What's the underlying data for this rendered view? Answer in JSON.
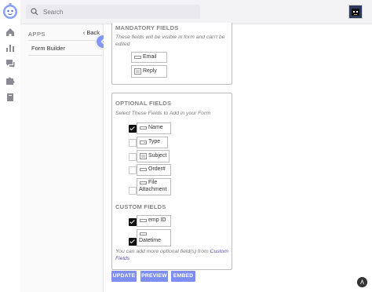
{
  "search": {
    "placeholder": "Search"
  },
  "apps": {
    "header": "APPS",
    "back_label": "Back",
    "items": [
      {
        "label": "Form Builder"
      }
    ]
  },
  "mandatory": {
    "title": "MANDATORY FIELDS",
    "description": "These fields will be visible in form and can't be edited",
    "fields": [
      {
        "label": "Email"
      },
      {
        "label": "Reply"
      }
    ]
  },
  "optional": {
    "title": "OPTIONAL FIELDS",
    "description": "Select These Fields to Add in your Form",
    "fields": [
      {
        "label": "Name",
        "checked": true
      },
      {
        "label": "Type",
        "checked": false
      },
      {
        "label": "Subject",
        "checked": false
      },
      {
        "label": "Order#",
        "checked": false
      },
      {
        "label": "File",
        "label2": "Attachment",
        "checked": false
      }
    ]
  },
  "custom": {
    "title": "CUSTOM FIELDS",
    "fields": [
      {
        "label": "emp ID",
        "checked": true
      },
      {
        "label": "Datetime",
        "checked": true
      }
    ],
    "note_prefix": "You can add more optional field(s) from",
    "note_link": "Custom",
    "note_link2": "Fields"
  },
  "buttons": {
    "update": "UPDATE",
    "preview": "PREVIEW",
    "embed": "EMBED"
  },
  "colors": {
    "accent": "#7f8ff0",
    "link": "#5a4fb8"
  }
}
